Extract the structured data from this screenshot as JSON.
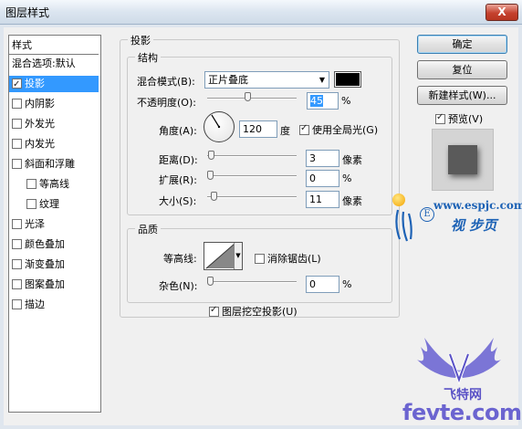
{
  "window": {
    "title": "图层样式",
    "close_glyph": "X"
  },
  "style_list": {
    "header": "样式",
    "items": [
      {
        "label": "混合选项:默认",
        "checkbox": false,
        "checked": false,
        "selected": false,
        "indent": 0
      },
      {
        "label": "投影",
        "checkbox": true,
        "checked": true,
        "selected": true,
        "indent": 0
      },
      {
        "label": "内阴影",
        "checkbox": true,
        "checked": false,
        "selected": false,
        "indent": 0
      },
      {
        "label": "外发光",
        "checkbox": true,
        "checked": false,
        "selected": false,
        "indent": 0
      },
      {
        "label": "内发光",
        "checkbox": true,
        "checked": false,
        "selected": false,
        "indent": 0
      },
      {
        "label": "斜面和浮雕",
        "checkbox": true,
        "checked": false,
        "selected": false,
        "indent": 0
      },
      {
        "label": "等高线",
        "checkbox": true,
        "checked": false,
        "selected": false,
        "indent": 1
      },
      {
        "label": "纹理",
        "checkbox": true,
        "checked": false,
        "selected": false,
        "indent": 1
      },
      {
        "label": "光泽",
        "checkbox": true,
        "checked": false,
        "selected": false,
        "indent": 0
      },
      {
        "label": "颜色叠加",
        "checkbox": true,
        "checked": false,
        "selected": false,
        "indent": 0
      },
      {
        "label": "渐变叠加",
        "checkbox": true,
        "checked": false,
        "selected": false,
        "indent": 0
      },
      {
        "label": "图案叠加",
        "checkbox": true,
        "checked": false,
        "selected": false,
        "indent": 0
      },
      {
        "label": "描边",
        "checkbox": true,
        "checked": false,
        "selected": false,
        "indent": 0
      }
    ]
  },
  "drop_shadow": {
    "title": "投影",
    "structure": {
      "title": "结构",
      "blend_mode_label": "混合模式(B):",
      "blend_mode_value": "正片叠底",
      "shadow_color": "#000000",
      "opacity_label": "不透明度(O):",
      "opacity_value": "45",
      "opacity_level": 0.45,
      "percent": "%",
      "angle_label": "角度(A):",
      "angle_value": "120",
      "angle_unit": "度",
      "global_light_label": "使用全局光(G)",
      "global_light_checked": true,
      "distance_label": "距离(D):",
      "distance_value": "3",
      "distance_level": 0.012,
      "spread_label": "扩展(R):",
      "spread_value": "0",
      "spread_level": 0.0,
      "size_label": "大小(S):",
      "size_value": "11",
      "size_level": 0.044,
      "px_unit": "像素"
    },
    "quality": {
      "title": "品质",
      "contour_label": "等高线:",
      "anti_alias_label": "消除锯齿(L)",
      "anti_alias_checked": false,
      "noise_label": "杂色(N):",
      "noise_value": "0",
      "noise_level": 0.0,
      "percent": "%"
    },
    "knockout_label": "图层挖空投影(U)",
    "knockout_checked": true
  },
  "buttons": {
    "ok": "确定",
    "reset": "复位",
    "new_style": "新建样式(W)...",
    "preview_label": "预览(V)",
    "preview_checked": true
  },
  "watermark": {
    "site": "www.espjc.com",
    "circle_letter": "E",
    "brand": "视 步页",
    "bottom_brand": "飞特网",
    "bottom_site": "fevte.com"
  },
  "colors": {
    "selection": "#3399ff",
    "watermark_blue": "#1d62b5",
    "wing_purple": "#7b75d6"
  }
}
